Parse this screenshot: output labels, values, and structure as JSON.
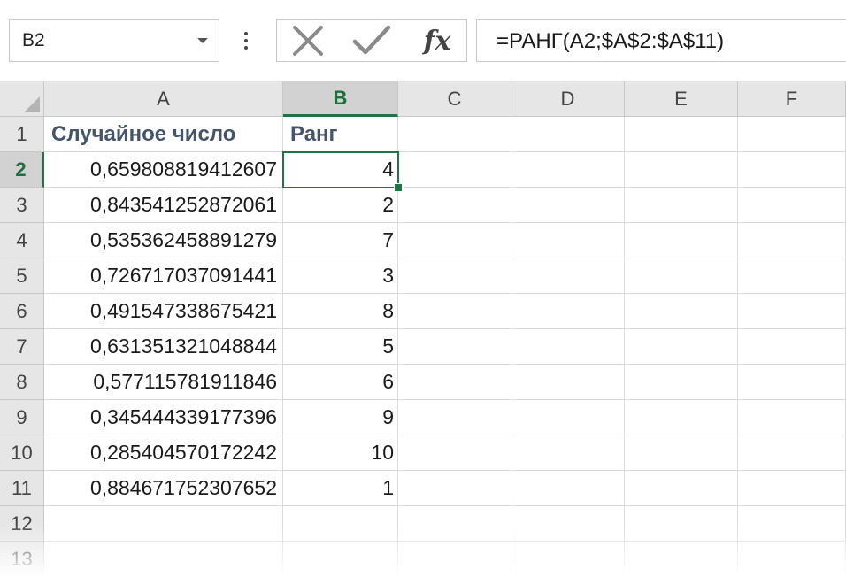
{
  "formula_bar": {
    "name_box": "B2",
    "formula": "=РАНГ(A2;$A$2:$A$11)",
    "icons": [
      "chevron-down-icon",
      "more-options-icon",
      "cancel-icon",
      "confirm-icon",
      "insert-function-icon"
    ],
    "insert_function_label": "fx"
  },
  "sheet": {
    "columns": [
      "A",
      "B",
      "C",
      "D",
      "E",
      "F"
    ],
    "selected_column": "B",
    "selected_row": "2",
    "rows": [
      {
        "num": "1",
        "a": "Случайное число",
        "b": "Ранг"
      },
      {
        "num": "2",
        "a": "0,659808819412607",
        "b": "4"
      },
      {
        "num": "3",
        "a": "0,843541252872061",
        "b": "2"
      },
      {
        "num": "4",
        "a": "0,535362458891279",
        "b": "7"
      },
      {
        "num": "5",
        "a": "0,726717037091441",
        "b": "3"
      },
      {
        "num": "6",
        "a": "0,491547338675421",
        "b": "8"
      },
      {
        "num": "7",
        "a": "0,631351321048844",
        "b": "5"
      },
      {
        "num": "8",
        "a": "0,577115781911846",
        "b": "6"
      },
      {
        "num": "9",
        "a": "0,345444339177396",
        "b": "9"
      },
      {
        "num": "10",
        "a": "0,285404570172242",
        "b": "10"
      },
      {
        "num": "11",
        "a": "0,884671752307652",
        "b": "1"
      },
      {
        "num": "12",
        "a": "",
        "b": ""
      },
      {
        "num": "13",
        "a": "",
        "b": ""
      }
    ]
  },
  "colors": {
    "accent": "#217346",
    "header_bg": "#e6e6e6",
    "selected_header_bg": "#d2d2d2",
    "title_text": "#44546a"
  }
}
